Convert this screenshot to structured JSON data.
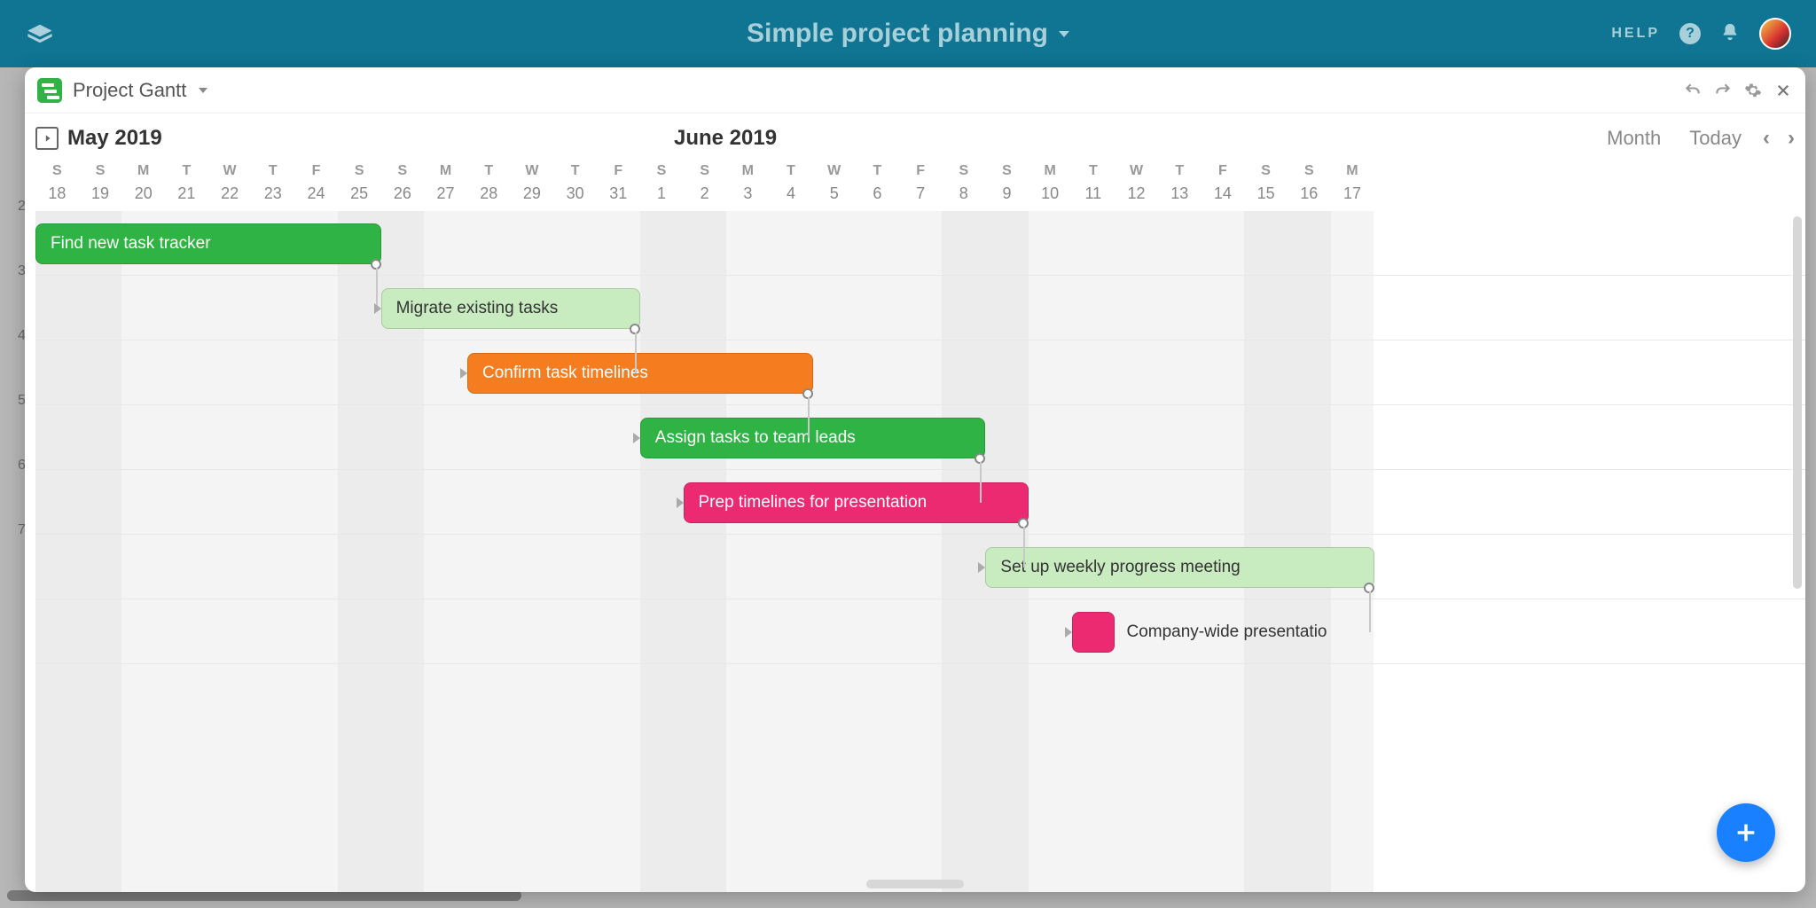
{
  "app": {
    "title": "Simple project planning",
    "help_label": "HELP"
  },
  "panel": {
    "title": "Project Gantt"
  },
  "toolbar": {
    "month1": "May 2019",
    "month2": "June 2019",
    "scale": "Month",
    "today": "Today"
  },
  "calendar": {
    "days": [
      {
        "dow": "S",
        "dom": "18"
      },
      {
        "dow": "S",
        "dom": "19"
      },
      {
        "dow": "M",
        "dom": "20"
      },
      {
        "dow": "T",
        "dom": "21"
      },
      {
        "dow": "W",
        "dom": "22"
      },
      {
        "dow": "T",
        "dom": "23"
      },
      {
        "dow": "F",
        "dom": "24"
      },
      {
        "dow": "S",
        "dom": "25"
      },
      {
        "dow": "S",
        "dom": "26"
      },
      {
        "dow": "M",
        "dom": "27"
      },
      {
        "dow": "T",
        "dom": "28"
      },
      {
        "dow": "W",
        "dom": "29"
      },
      {
        "dow": "T",
        "dom": "30"
      },
      {
        "dow": "F",
        "dom": "31"
      },
      {
        "dow": "S",
        "dom": "1"
      },
      {
        "dow": "S",
        "dom": "2"
      },
      {
        "dow": "M",
        "dom": "3"
      },
      {
        "dow": "T",
        "dom": "4"
      },
      {
        "dow": "W",
        "dom": "5"
      },
      {
        "dow": "T",
        "dom": "6"
      },
      {
        "dow": "F",
        "dom": "7"
      },
      {
        "dow": "S",
        "dom": "8"
      },
      {
        "dow": "S",
        "dom": "9"
      },
      {
        "dow": "M",
        "dom": "10"
      },
      {
        "dow": "T",
        "dom": "11"
      },
      {
        "dow": "W",
        "dom": "12"
      },
      {
        "dow": "T",
        "dom": "13"
      },
      {
        "dow": "F",
        "dom": "14"
      },
      {
        "dow": "S",
        "dom": "15"
      },
      {
        "dow": "S",
        "dom": "16"
      },
      {
        "dow": "M",
        "dom": "17"
      }
    ],
    "weekend_indices": [
      0,
      1,
      7,
      8,
      14,
      15,
      21,
      22,
      28,
      29
    ]
  },
  "tasks": [
    {
      "label": "Find new task tracker",
      "start": 0,
      "span": 8,
      "style": "green-solid"
    },
    {
      "label": "Migrate existing tasks",
      "start": 8,
      "span": 6,
      "style": "green-light"
    },
    {
      "label": "Confirm task timelines",
      "start": 10,
      "span": 8,
      "style": "orange"
    },
    {
      "label": "Assign tasks to team leads",
      "start": 14,
      "span": 8,
      "style": "green-solid"
    },
    {
      "label": "Prep timelines for presentation",
      "start": 15,
      "span": 8,
      "style": "pink"
    },
    {
      "label": "Set up weekly progress meeting",
      "start": 22,
      "span": 9,
      "style": "green-light"
    },
    {
      "label": "Company-wide presentatio",
      "start": 24,
      "span": 1,
      "style": "pink-small",
      "ext": true
    }
  ],
  "bg_rows": [
    "2",
    "3",
    "4",
    "5",
    "6",
    "7"
  ],
  "chart_data": {
    "type": "gantt",
    "date_range": {
      "start": "2019-05-18",
      "end": "2019-06-17"
    },
    "scale": "Month",
    "tasks": [
      {
        "name": "Find new task tracker",
        "start": "2019-05-18",
        "end": "2019-05-25",
        "color": "green"
      },
      {
        "name": "Migrate existing tasks",
        "start": "2019-05-26",
        "end": "2019-05-31",
        "color": "light-green",
        "depends_on": 0
      },
      {
        "name": "Confirm task timelines",
        "start": "2019-05-28",
        "end": "2019-06-04",
        "color": "orange",
        "depends_on": 1
      },
      {
        "name": "Assign tasks to team leads",
        "start": "2019-06-01",
        "end": "2019-06-08",
        "color": "green",
        "depends_on": 2
      },
      {
        "name": "Prep timelines for presentation",
        "start": "2019-06-02",
        "end": "2019-06-09",
        "color": "pink",
        "depends_on": 3
      },
      {
        "name": "Set up weekly progress meeting",
        "start": "2019-06-09",
        "end": "2019-06-17",
        "color": "light-green",
        "depends_on": 4
      },
      {
        "name": "Company-wide presentation",
        "start": "2019-06-11",
        "end": "2019-06-11",
        "color": "pink",
        "depends_on": 5
      }
    ]
  }
}
